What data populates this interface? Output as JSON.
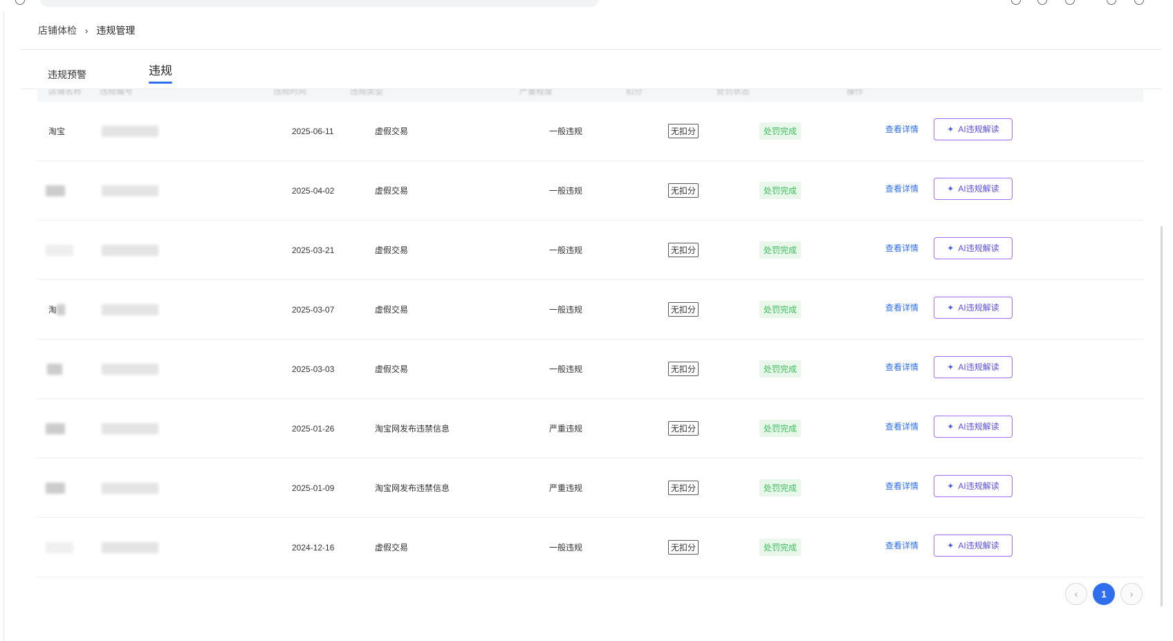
{
  "breadcrumb": {
    "parent": "店铺体检",
    "separator": "›",
    "current": "违规管理"
  },
  "tabs": [
    {
      "label": "违规预警"
    },
    {
      "label": "违规"
    }
  ],
  "table": {
    "columns": [
      "店铺名称",
      "违规编号",
      "违规时间",
      "违规类型",
      "严重程度",
      "扣分",
      "处罚状态",
      "操作"
    ],
    "rows": [
      {
        "shop": "淘宝",
        "date": "2025-06-11",
        "type": "虚假交易",
        "severity": "一般违规",
        "score": "无扣分",
        "status": "处罚完成",
        "detail": "查看详情",
        "ai": "AI违规解读"
      },
      {
        "shop": "",
        "date": "2025-04-02",
        "type": "虚假交易",
        "severity": "一般违规",
        "score": "无扣分",
        "status": "处罚完成",
        "detail": "查看详情",
        "ai": "AI违规解读"
      },
      {
        "shop": "",
        "date": "2025-03-21",
        "type": "虚假交易",
        "severity": "一般违规",
        "score": "无扣分",
        "status": "处罚完成",
        "detail": "查看详情",
        "ai": "AI违规解读"
      },
      {
        "shop": "淘",
        "date": "2025-03-07",
        "type": "虚假交易",
        "severity": "一般违规",
        "score": "无扣分",
        "status": "处罚完成",
        "detail": "查看详情",
        "ai": "AI违规解读"
      },
      {
        "shop": "",
        "date": "2025-03-03",
        "type": "虚假交易",
        "severity": "一般违规",
        "score": "无扣分",
        "status": "处罚完成",
        "detail": "查看详情",
        "ai": "AI违规解读"
      },
      {
        "shop": "",
        "date": "2025-01-26",
        "type": "淘宝网发布违禁信息",
        "severity": "严重违规",
        "score": "无扣分",
        "status": "处罚完成",
        "detail": "查看详情",
        "ai": "AI违规解读"
      },
      {
        "shop": "",
        "date": "2025-01-09",
        "type": "淘宝网发布违禁信息",
        "severity": "严重违规",
        "score": "无扣分",
        "status": "处罚完成",
        "detail": "查看详情",
        "ai": "AI违规解读"
      },
      {
        "shop": "",
        "date": "2024-12-16",
        "type": "虚假交易",
        "severity": "一般违规",
        "score": "无扣分",
        "status": "处罚完成",
        "detail": "查看详情",
        "ai": "AI违规解读"
      }
    ]
  },
  "ai_icon": "sparkle-icon",
  "pagination": {
    "prev": "‹",
    "current": "1",
    "next": "›"
  },
  "colors": {
    "accent": "#2f6fed",
    "status_green": "#3bbf5b",
    "ai_border": "#a66cf2"
  }
}
